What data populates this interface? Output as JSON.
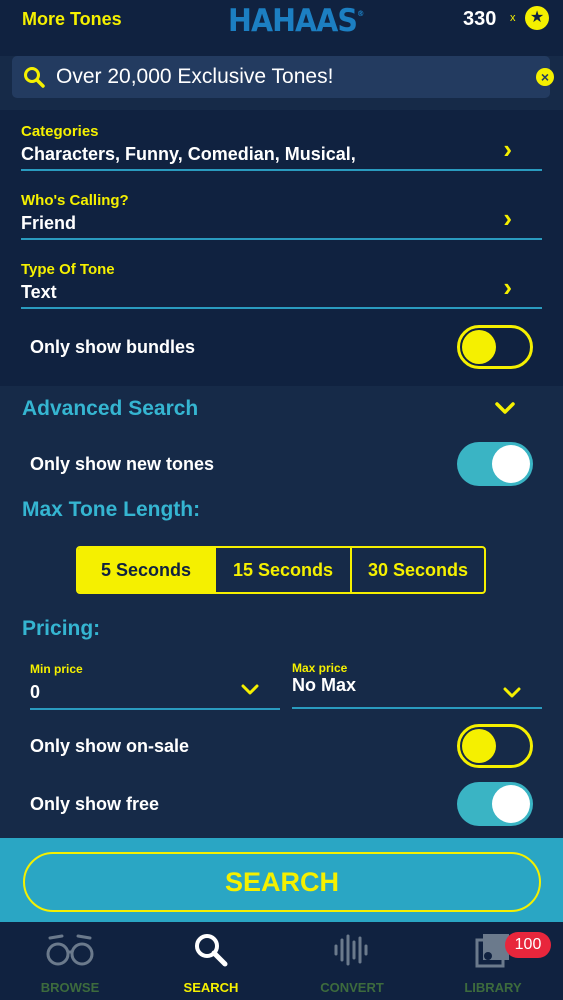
{
  "header": {
    "more_tones": "More Tones",
    "logo": "HAHAAS",
    "logo_mark": "®",
    "coin_count": "330",
    "coin_x": "x",
    "coin_symbol": "★"
  },
  "search": {
    "text": "Over 20,000 Exclusive Tones!",
    "clear_symbol": "×"
  },
  "filters": {
    "categories_label": "Categories",
    "categories_value": "Characters, Funny, Comedian, Musical,",
    "caller_label": "Who's Calling?",
    "caller_value": "Friend",
    "type_label": "Type Of Tone",
    "type_value": "Text",
    "chevron": "›",
    "bundles_label": "Only show bundles",
    "bundles_on": false
  },
  "advanced": {
    "title": "Advanced Search",
    "chevron": "⌄",
    "new_tones_label": "Only show new tones",
    "new_tones_on": true,
    "max_length_title": "Max Tone Length:",
    "length_options": [
      "5 Seconds",
      "15 Seconds",
      "30 Seconds"
    ],
    "length_selected": "5 Seconds",
    "pricing_title": "Pricing:",
    "min_price_label": "Min price",
    "min_price_value": "0",
    "max_price_label": "Max price",
    "max_price_value": "No Max",
    "on_sale_label": "Only show on-sale",
    "on_sale_on": false,
    "free_label": "Only show free",
    "free_on": true
  },
  "search_button": "SEARCH",
  "tabs": [
    {
      "label": "BROWSE",
      "icon": "binoculars-icon",
      "active": false
    },
    {
      "label": "SEARCH",
      "icon": "search-icon",
      "active": true
    },
    {
      "label": "CONVERT",
      "icon": "waveform-icon",
      "active": false
    },
    {
      "label": "LIBRARY",
      "icon": "music-library-icon",
      "active": false
    }
  ],
  "library_badge": "100",
  "colors": {
    "accent": "#f5f000",
    "teal": "#35b5d1",
    "navy": "#102240",
    "badge": "#e8263c"
  }
}
